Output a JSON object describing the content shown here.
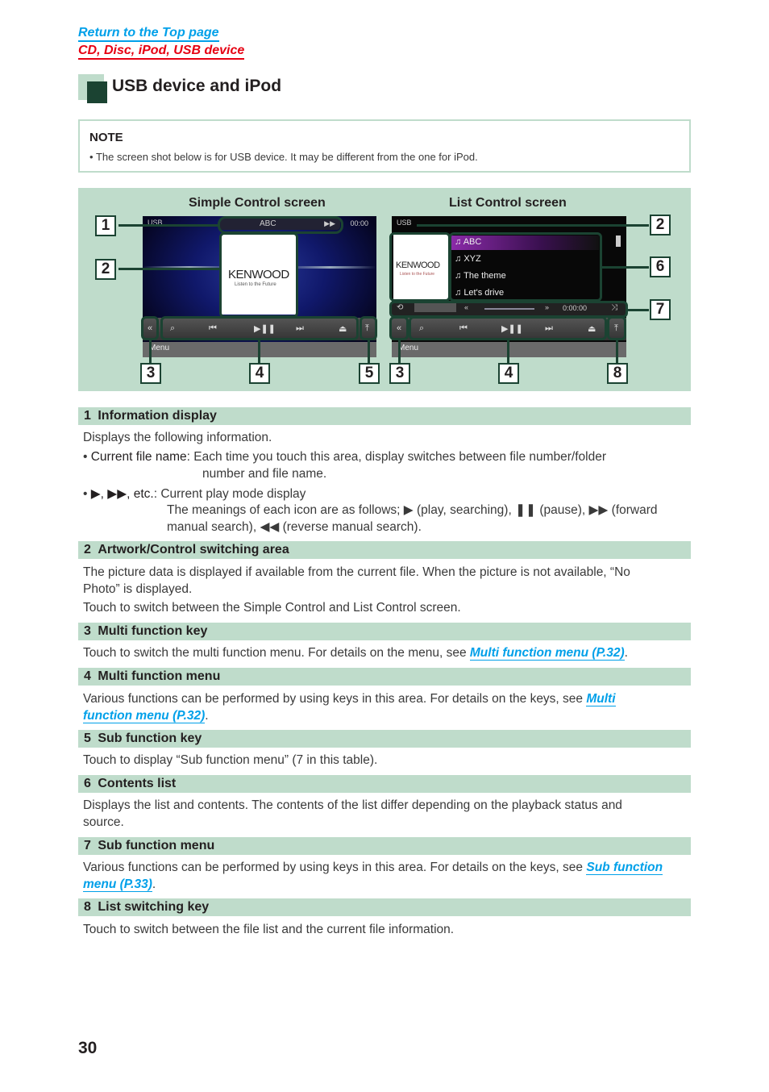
{
  "nav": {
    "return_top": "Return to the Top page",
    "section_link": "CD, Disc, iPod, USB device"
  },
  "page_title": "USB device and iPod",
  "note": {
    "heading": "NOTE",
    "text": "The screen shot below is for USB device. It may be different from the one for iPod."
  },
  "figure": {
    "simple_caption": "Simple Control screen",
    "list_caption": "List Control screen",
    "simple": {
      "source": "USB",
      "file_name": "ABC",
      "play_mode": "▶▶",
      "time": "00:00",
      "logo": "KENWOOD",
      "tagline": "Listen to the Future",
      "menu_label": "Menu",
      "keys": [
        "search",
        "previous",
        "play-pause",
        "next",
        "eject"
      ]
    },
    "list": {
      "source": "USB",
      "logo": "KENWOOD",
      "tagline": "Listen to the Future",
      "items": [
        "ABC",
        "XYZ",
        "The theme",
        "Let's drive"
      ],
      "sub_time": "0:00:00",
      "menu_label": "Menu"
    },
    "callouts_simple": [
      "1",
      "2",
      "3",
      "4",
      "5"
    ],
    "callouts_list": [
      "2",
      "6",
      "7",
      "3",
      "4",
      "8"
    ]
  },
  "sections": [
    {
      "num": "1",
      "title": "Information display"
    },
    {
      "num": "2",
      "title": "Artwork/Control switching area"
    },
    {
      "num": "3",
      "title": "Multi function key"
    },
    {
      "num": "4",
      "title": "Multi function menu"
    },
    {
      "num": "5",
      "title": "Sub function key"
    },
    {
      "num": "6",
      "title": "Contents list"
    },
    {
      "num": "7",
      "title": "Sub function menu"
    },
    {
      "num": "8",
      "title": "List switching key"
    }
  ],
  "text": {
    "s1_intro": "Displays the following information.",
    "s1_b1_term": "Current file name",
    "s1_b1_desc": ": Each time you touch this area, display switches between file number/folder",
    "s1_b1_cont": "number and file name.",
    "s1_b2_term": "▶, ▶▶, etc.",
    "s1_b2_desc": ": Current play mode display",
    "s1_b2_l2": "The meanings of each icon are as follows; ▶ (play, searching), ❚❚ (pause), ▶▶ (forward",
    "s1_b2_l3": "manual search), ◀◀ (reverse manual search).",
    "s2_p1": "The picture data is displayed if available from the current file. When the picture is not available, “No Photo” is displayed.",
    "s2_p2": "Touch to switch between the Simple Control and List Control screen.",
    "s3_p": "Touch to switch the multi function menu. For details on the menu, see ",
    "s3_link": "Multi function menu (P.32)",
    "s4_p": "Various functions can be performed by using keys in this area. For details on the keys, see ",
    "s4_link": "Multi function menu (P.32)",
    "s5_p": "Touch to display “Sub function menu” (7 in this table).",
    "s6_p": "Displays the list and contents. The contents of the list differ depending on the playback status and source.",
    "s7_p": "Various functions can be performed by using keys in this area. For details on the keys, see ",
    "s7_link": "Sub function menu (P.33)",
    "s8_p": "Touch to switch between the file list and the current file information.",
    "period": "."
  },
  "page_number": "30",
  "colors": {
    "link_blue": "#00a0e9",
    "link_red": "#e60012",
    "accent_green": "#bfdccb",
    "dark_green": "#1b4332"
  }
}
